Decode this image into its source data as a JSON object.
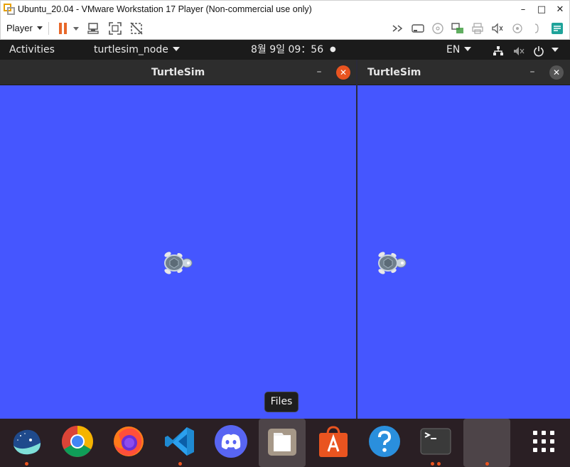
{
  "vmware": {
    "window_title": "Ubuntu_20.04 - VMware Workstation 17 Player (Non-commercial use only)",
    "minimize_glyph": "–",
    "maximize_glyph": "□",
    "close_glyph": "✕",
    "player_menu_label": "Player",
    "toolbar_icons": [
      "pause-icon",
      "send-ctrl-alt-del-icon",
      "fullscreen-icon",
      "unity-icon"
    ],
    "right_icons": [
      "more-devices-icon",
      "hard-disk-icon",
      "cd-icon",
      "network-icon",
      "printer-icon",
      "sound-icon",
      "usb-icon",
      "devices-more-icon",
      "message-log-icon"
    ]
  },
  "ubuntu_topbar": {
    "activities": "Activities",
    "app_menu": "turtlesim_node",
    "clock": "8월 9일  09：56",
    "record_dot": "●",
    "language": "EN",
    "status_icons": [
      "network-icon",
      "volume-muted-icon",
      "power-icon"
    ]
  },
  "windows": [
    {
      "title": "TurtleSim",
      "focused": true,
      "min_glyph": "–",
      "close_glyph": "✕"
    },
    {
      "title": "TurtleSim",
      "focused": false,
      "min_glyph": "–",
      "close_glyph": "✕"
    }
  ],
  "canvas_color": "#4556ff",
  "tooltip": {
    "text": "Files"
  },
  "dock": {
    "items": [
      {
        "name": "whale-browser",
        "icon": "whale-icon",
        "running": true,
        "active": false
      },
      {
        "name": "chrome",
        "icon": "chrome-icon",
        "running": false,
        "active": false
      },
      {
        "name": "firefox",
        "icon": "firefox-icon",
        "running": false,
        "active": false
      },
      {
        "name": "vscode",
        "icon": "vscode-icon",
        "running": true,
        "active": false
      },
      {
        "name": "discord",
        "icon": "discord-icon",
        "running": false,
        "active": false
      },
      {
        "name": "files",
        "icon": "files-icon",
        "running": false,
        "active": true
      },
      {
        "name": "ubuntu-software",
        "icon": "software-icon",
        "running": false,
        "active": false
      },
      {
        "name": "help",
        "icon": "help-icon",
        "running": false,
        "active": false
      },
      {
        "name": "terminal",
        "icon": "terminal-icon",
        "running": true,
        "active": false
      },
      {
        "name": "turtlesim-app",
        "icon": "blank-app-icon",
        "running": true,
        "active": true
      },
      {
        "name": "show-applications",
        "icon": "app-grid-icon",
        "running": false,
        "active": false
      }
    ]
  },
  "colors": {
    "ubuntu_orange": "#e95420",
    "topbar_bg": "#1b1b1b",
    "dock_bg": "#2a1f24",
    "window_header": "#2d2d2d"
  }
}
